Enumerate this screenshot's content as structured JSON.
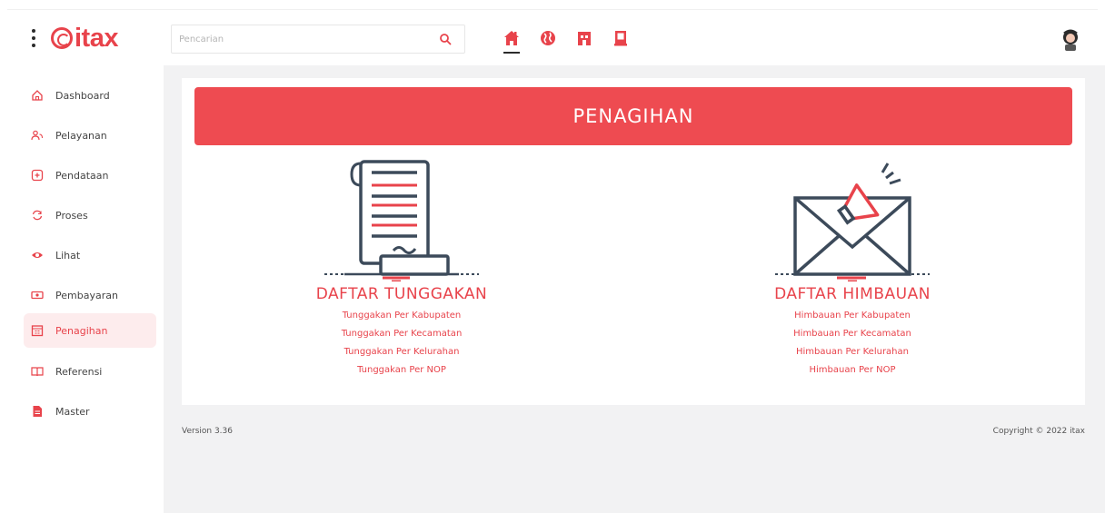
{
  "app": {
    "logo_text": "itax",
    "brand_color": "#e8434b"
  },
  "search": {
    "placeholder": "Pencarian",
    "value": ""
  },
  "nav": [
    {
      "icon": "home-icon",
      "active": true
    },
    {
      "icon": "globe-icon",
      "active": false
    },
    {
      "icon": "building-icon",
      "active": false
    },
    {
      "icon": "document-icon",
      "active": false
    }
  ],
  "sidebar": {
    "items": [
      {
        "label": "Dashboard",
        "icon": "home-outline-icon"
      },
      {
        "label": "Pelayanan",
        "icon": "users-icon"
      },
      {
        "label": "Pendataan",
        "icon": "plus-box-icon"
      },
      {
        "label": "Proses",
        "icon": "cycle-icon"
      },
      {
        "label": "Lihat",
        "icon": "eye-icon"
      },
      {
        "label": "Pembayaran",
        "icon": "money-icon"
      },
      {
        "label": "Penagihan",
        "icon": "calendar-icon",
        "active": true
      },
      {
        "label": "Referensi",
        "icon": "book-icon"
      },
      {
        "label": "Master",
        "icon": "file-icon"
      }
    ]
  },
  "main": {
    "banner_title": "PENAGIHAN",
    "sections": [
      {
        "title": "DAFTAR TUNGGAKAN",
        "icon": "receipt-icon",
        "links": [
          "Tunggakan Per Kabupaten",
          "Tunggakan Per Kecamatan",
          "Tunggakan Per Kelurahan",
          "Tunggakan Per NOP"
        ]
      },
      {
        "title": "DAFTAR HIMBAUAN",
        "icon": "megaphone-envelope-icon",
        "links": [
          "Himbauan Per Kabupaten",
          "Himbauan Per Kecamatan",
          "Himbauan Per Kelurahan",
          "Himbauan Per NOP"
        ]
      }
    ]
  },
  "footer": {
    "version": "Version 3.36",
    "copyright": "Copyright © 2022 itax"
  }
}
